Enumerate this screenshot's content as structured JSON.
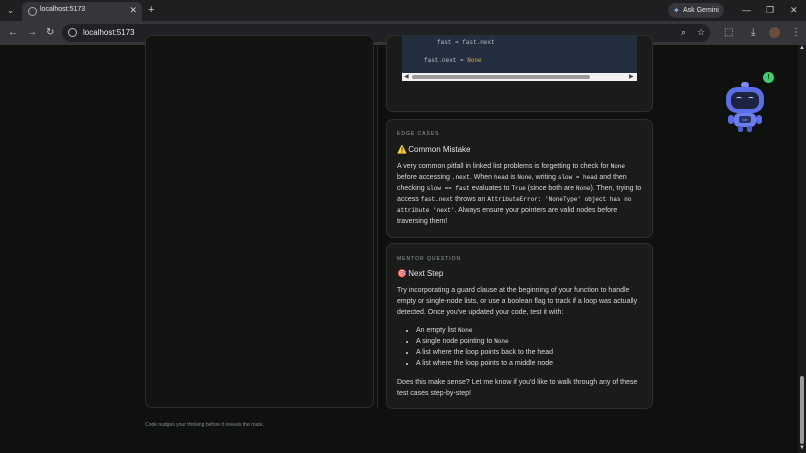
{
  "browser": {
    "tab_title": "localhost:5173",
    "tab_close": "✕",
    "new_tab": "+",
    "tab_list": "⌄",
    "ask_gemini": "Ask Gemini",
    "minimize": "—",
    "restore": "❐",
    "close": "✕",
    "url": "localhost:5173",
    "back": "←",
    "forward": "→",
    "reload": "↻",
    "zoom_icon": "⌕",
    "bookmark_icon": "☆",
    "extensions_icon": "⬚",
    "download_icon": "⤓",
    "menu_icon": "⋮"
  },
  "code_snippet": {
    "line1_var": "fast",
    "line1_rest": " = fast.next",
    "line2_left": "fast.next",
    "line2_op": " = ",
    "line2_val": "None",
    "scroll_left": "◀",
    "scroll_right": "▶"
  },
  "edge_cases": {
    "eyebrow": "EDGE CASES",
    "emoji": "⚠️",
    "title": "Common Mistake",
    "t1": "A very common pitfall in linked list problems is forgetting to check for ",
    "c1": "None",
    "t2": " before accessing ",
    "c2": ".next",
    "t3": ". When ",
    "c3": "head",
    "t4": " is ",
    "c4": "None",
    "t5": ", writing ",
    "c5": "slow = head",
    "t6": " and then checking ",
    "c6": "slow == fast",
    "t7": " evaluates to ",
    "c7": "True",
    "t8": " (since both are ",
    "c8": "None",
    "t9": "). Then, trying to access ",
    "c9": "fast.next",
    "t10": " throws an ",
    "c10": "AttributeError: 'NoneType' object has no attribute 'next'",
    "t11": ". Always ensure your pointers are valid nodes before traversing them!"
  },
  "mentor": {
    "eyebrow": "MENTOR QUESTION",
    "emoji": "🎯",
    "title": "Next Step",
    "intro": "Try incorporating a guard clause at the beginning of your function to handle empty or single-node lists, or use a boolean flag to track if a loop was actually detected. Once you've updated your code, test it with:",
    "b1_text": "An empty list ",
    "b1_code": "None",
    "b2_text": "A single node pointing to ",
    "b2_code": "None",
    "b3": "A list where the loop points back to the head",
    "b4": "A list where the loop points to a middle node",
    "outro": "Does this make sense? Let me know if you'd like to walk through any of these test cases step-by-step!"
  },
  "footer": "Code nudges your thinking before it reveals the route.",
  "mascot": {
    "badge": "!",
    "screen_text": "=>",
    "colors": {
      "body": "#5b6de8",
      "badge": "#3ccf6b"
    }
  },
  "scrollbar": {
    "up": "▲",
    "down": "▼"
  }
}
